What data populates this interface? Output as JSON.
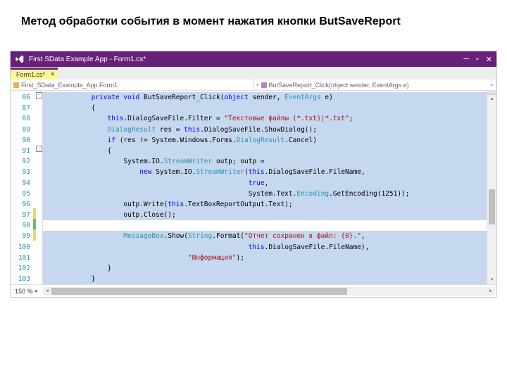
{
  "slide": {
    "title": "Метод обработки события в момент нажатия кнопки ButSaveReport"
  },
  "window": {
    "title": "First SData Example App - Form1.cs*",
    "tab": "Form1.cs*",
    "breadcrumb_left": "First_SData_Example_App.Form1",
    "breadcrumb_right": "ButSaveReport_Click(object sender, EventArgs e)"
  },
  "zoom": "150 %",
  "gutter_start": 86,
  "line_count": 18,
  "change_marks": [
    "",
    "",
    "",
    "",
    "",
    "",
    "",
    "",
    "",
    "",
    "",
    "yellow",
    "green",
    "yellow",
    "",
    "",
    "",
    ""
  ],
  "code": [
    {
      "sel": true,
      "tokens": [
        [
          "id",
          "            "
        ],
        [
          "kw",
          "private void"
        ],
        [
          "id",
          " ButSaveReport_Click("
        ],
        [
          "kw",
          "object"
        ],
        [
          "id",
          " sender, "
        ],
        [
          "type",
          "EventArgs"
        ],
        [
          "id",
          " e)"
        ]
      ]
    },
    {
      "sel": true,
      "tokens": [
        [
          "id",
          "            {"
        ]
      ]
    },
    {
      "sel": true,
      "tokens": [
        [
          "id",
          "                "
        ],
        [
          "kw",
          "this"
        ],
        [
          "id",
          ".DialogSaveFile.Filter = "
        ],
        [
          "str",
          "\"Текстовые файлы (*.txt)|*.txt\""
        ],
        [
          "id",
          ";"
        ]
      ]
    },
    {
      "sel": true,
      "tokens": [
        [
          "id",
          "                "
        ],
        [
          "type",
          "DialogResult"
        ],
        [
          "id",
          " res = "
        ],
        [
          "kw",
          "this"
        ],
        [
          "id",
          ".DialogSaveFile.ShowDialog();"
        ]
      ]
    },
    {
      "sel": true,
      "tokens": [
        [
          "id",
          "                "
        ],
        [
          "kw",
          "if"
        ],
        [
          "id",
          " (res != System.Windows.Forms."
        ],
        [
          "type",
          "DialogResult"
        ],
        [
          "id",
          ".Cancel)"
        ]
      ]
    },
    {
      "sel": true,
      "tokens": [
        [
          "id",
          "                {"
        ]
      ]
    },
    {
      "sel": true,
      "tokens": [
        [
          "id",
          "                    System.IO."
        ],
        [
          "type",
          "StreamWriter"
        ],
        [
          "id",
          " outp; outp ="
        ]
      ]
    },
    {
      "sel": true,
      "tokens": [
        [
          "id",
          "                        "
        ],
        [
          "kw",
          "new"
        ],
        [
          "id",
          " System.IO."
        ],
        [
          "type",
          "StreamWriter"
        ],
        [
          "id",
          "("
        ],
        [
          "kw",
          "this"
        ],
        [
          "id",
          ".DialogSaveFile.FileName,"
        ]
      ]
    },
    {
      "sel": true,
      "tokens": [
        [
          "id",
          "                                                   "
        ],
        [
          "kw",
          "true"
        ],
        [
          "id",
          ","
        ]
      ]
    },
    {
      "sel": true,
      "tokens": [
        [
          "id",
          "                                                   System.Text."
        ],
        [
          "type",
          "Encoding"
        ],
        [
          "id",
          ".GetEncoding(1251));"
        ]
      ]
    },
    {
      "sel": true,
      "tokens": [
        [
          "id",
          "                    outp.Write("
        ],
        [
          "kw",
          "this"
        ],
        [
          "id",
          ".TextBoxReportOutput.Text);"
        ]
      ]
    },
    {
      "sel": true,
      "tokens": [
        [
          "id",
          "                    outp.Close();"
        ]
      ]
    },
    {
      "sel": false,
      "tokens": [
        [
          "id",
          ""
        ]
      ]
    },
    {
      "sel": true,
      "tokens": [
        [
          "id",
          "                    "
        ],
        [
          "type",
          "MessageBox"
        ],
        [
          "id",
          ".Show("
        ],
        [
          "type",
          "String"
        ],
        [
          "id",
          ".Format("
        ],
        [
          "str",
          "\"Отчет сохранен в файл: {0}.\""
        ],
        [
          "id",
          ","
        ]
      ]
    },
    {
      "sel": true,
      "tokens": [
        [
          "id",
          "                                                   "
        ],
        [
          "kw",
          "this"
        ],
        [
          "id",
          ".DialogSaveFile.FileName),"
        ]
      ]
    },
    {
      "sel": true,
      "tokens": [
        [
          "id",
          "                                    "
        ],
        [
          "str",
          "\"Информация\""
        ],
        [
          "id",
          ");"
        ]
      ]
    },
    {
      "sel": true,
      "tokens": [
        [
          "id",
          "                }"
        ]
      ]
    },
    {
      "sel": true,
      "tokens": [
        [
          "id",
          "            }"
        ]
      ]
    }
  ]
}
